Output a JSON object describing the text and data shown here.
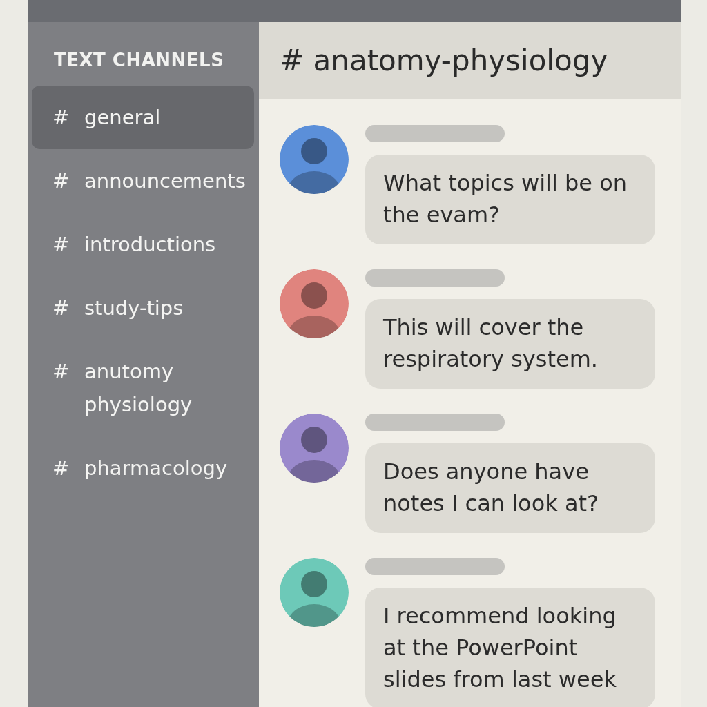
{
  "sidebar": {
    "heading": "TEXT CHANNELS",
    "channels": [
      {
        "prefix": "#",
        "name": "general",
        "selected": true
      },
      {
        "prefix": "#",
        "name": "announcements",
        "selected": false
      },
      {
        "prefix": "#",
        "name": "introductions",
        "selected": false
      },
      {
        "prefix": "#",
        "name": "study-tips",
        "selected": false
      },
      {
        "prefix": "#",
        "name": "anutomy physiology",
        "selected": false
      },
      {
        "prefix": "#",
        "name": "pharmacology",
        "selected": false
      }
    ]
  },
  "channel_header": {
    "title": "# anatomy-physiology"
  },
  "messages": [
    {
      "color": "#5b8fd9",
      "text": "What topics will be on the evam?"
    },
    {
      "color": "#e0847e",
      "text": "This will cover the respiratory system."
    },
    {
      "color": "#9a89cc",
      "text": "Does anyone have notes I can look at?"
    },
    {
      "color": "#6dc9b8",
      "text": "I recommend looking at the PowerPoint slides from last week"
    }
  ]
}
